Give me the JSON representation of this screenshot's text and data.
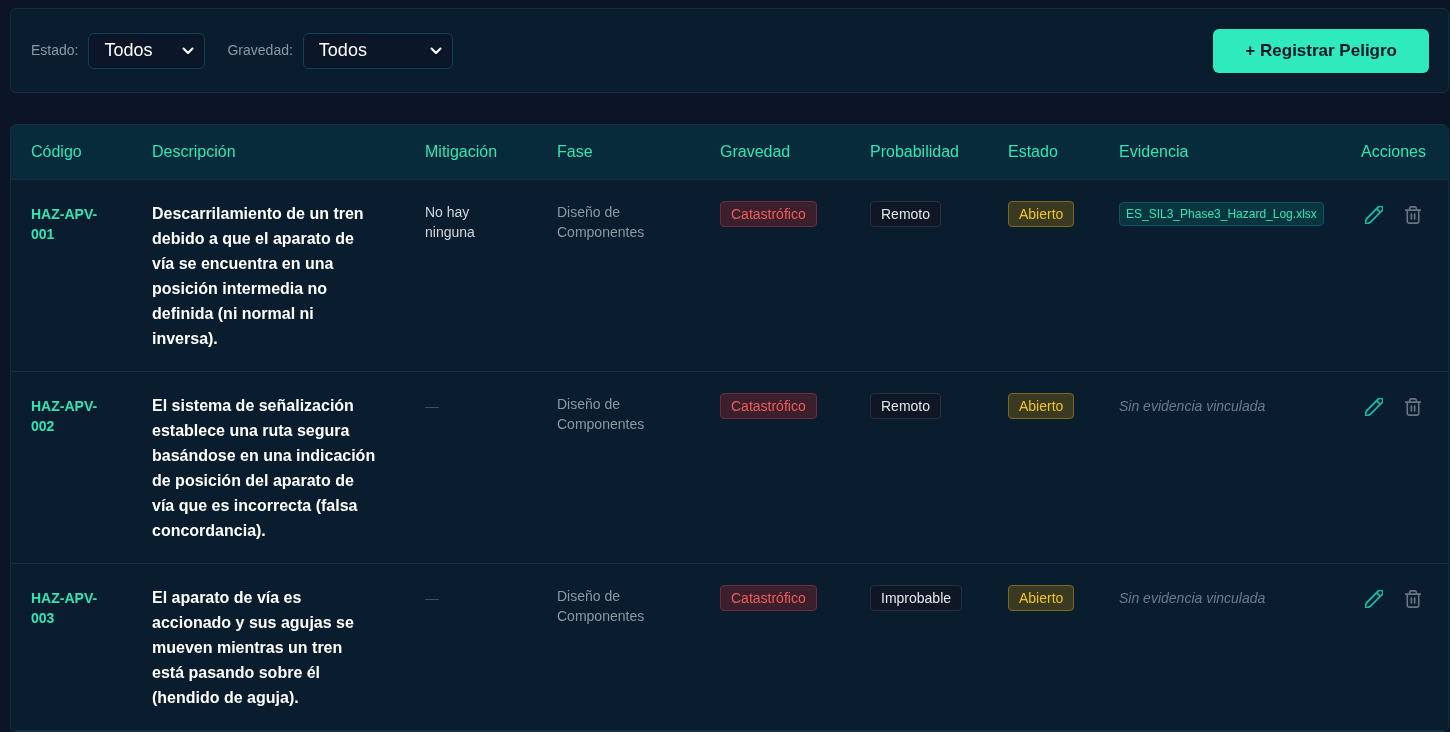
{
  "filters": [
    {
      "label": "Estado:",
      "value": "Todos"
    },
    {
      "label": "Gravedad:",
      "value": "Todos"
    }
  ],
  "register_button": {
    "label": "+ Registrar Peligro"
  },
  "table": {
    "columns": [
      "Código",
      "Descripción",
      "Mitigación",
      "Fase",
      "Gravedad",
      "Probabilidad",
      "Estado",
      "Evidencia",
      "Acciones"
    ],
    "rows": [
      {
        "code": "HAZ-APV-001",
        "description": "Descarrilamiento de un tren debido a que el aparato de vía se encuentra en una posición intermedia no definida (ni normal ni inversa).",
        "mitigation": {
          "kind": "text",
          "text": "No hay ninguna"
        },
        "phase": "Diseño de Componentes",
        "severity": "Catastrófico",
        "probability": "Remoto",
        "status": "Abierto",
        "evidence": {
          "kind": "file",
          "text": "ES_SIL3_Phase3_Hazard_Log.xlsx"
        }
      },
      {
        "code": "HAZ-APV-002",
        "description": "El sistema de señalización establece una ruta segura basándose en una indicación de posición del aparato de vía que es incorrecta (falsa concordancia).",
        "mitigation": {
          "kind": "empty",
          "text": "—"
        },
        "phase": "Diseño de Componentes",
        "severity": "Catastrófico",
        "probability": "Remoto",
        "status": "Abierto",
        "evidence": {
          "kind": "none",
          "text": "Sin evidencia vinculada"
        }
      },
      {
        "code": "HAZ-APV-003",
        "description": "El aparato de vía es accionado y sus agujas se mueven mientras un tren está pasando sobre él (hendido de aguja).",
        "mitigation": {
          "kind": "empty",
          "text": "—"
        },
        "phase": "Diseño de Componentes",
        "severity": "Catastrófico",
        "probability": "Improbable",
        "status": "Abierto",
        "evidence": {
          "kind": "none",
          "text": "Sin evidencia vinculada"
        }
      }
    ]
  }
}
